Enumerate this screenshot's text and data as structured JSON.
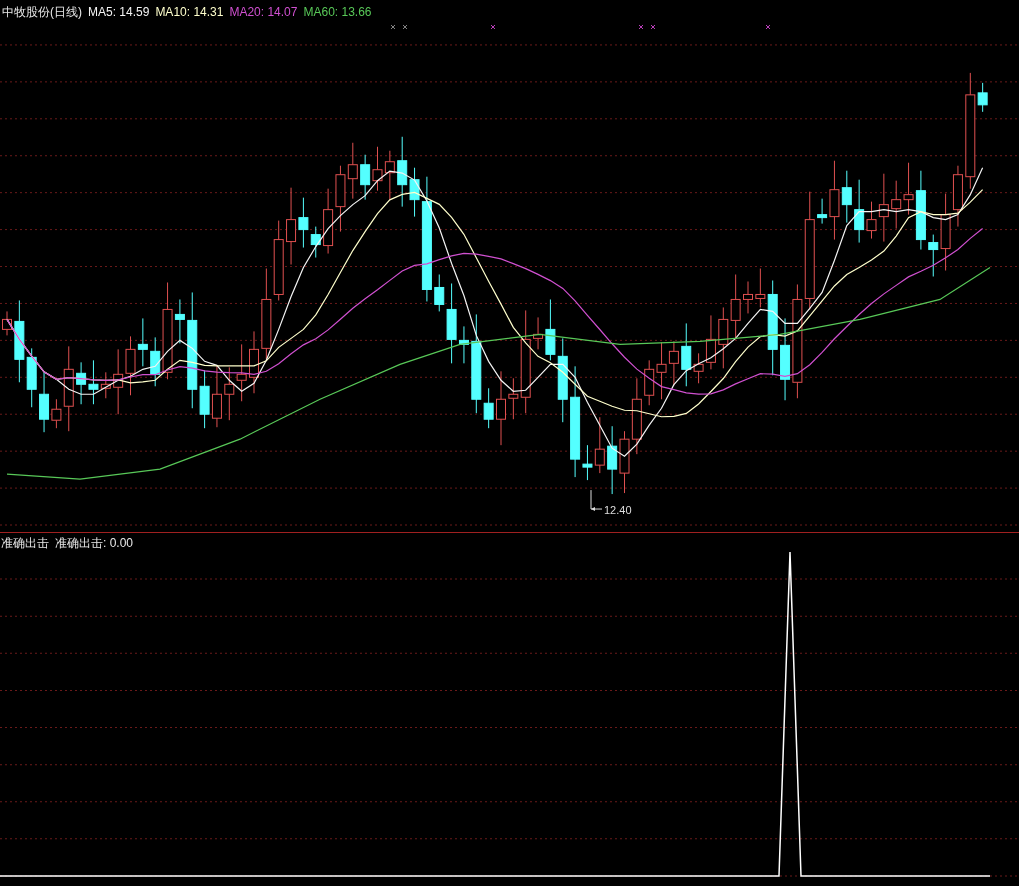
{
  "price_panel": {
    "stock_name": "中牧股份(日线)",
    "indicators": [
      {
        "label": "MA5: 14.59",
        "color": "#f4f4f4"
      },
      {
        "label": "MA10: 14.31",
        "color": "#ffffcc"
      },
      {
        "label": "MA20: 14.07",
        "color": "#d050d0"
      },
      {
        "label": "MA60: 13.66",
        "color": "#58c858"
      }
    ],
    "low_label": "12.40"
  },
  "indicator_panel": {
    "title": "准确出击",
    "readout": "准确出击: 0.00"
  }
}
